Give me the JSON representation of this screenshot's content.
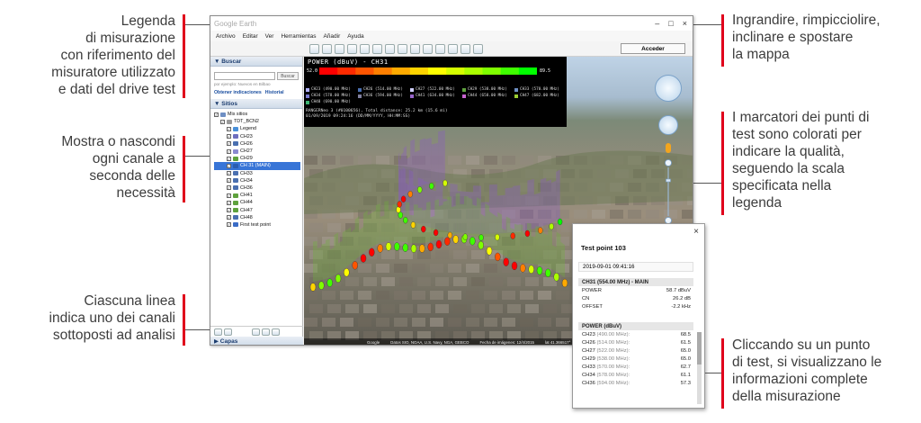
{
  "annotations": {
    "legend": [
      "Legenda",
      "di misurazione",
      "con riferimento del",
      "misuratore utilizzato",
      "e dati del drive test"
    ],
    "channels": [
      "Mostra o nascondi",
      "ogni canale a",
      "seconda delle",
      "necessità"
    ],
    "lines": [
      "Ciascuna linea",
      "indica uno dei canali",
      "sottoposti ad analisi"
    ],
    "zoom": [
      "Ingrandire, rimpicciolire,",
      "inclinare e spostare",
      "la mappa"
    ],
    "markers": [
      "I marcatori dei punti di",
      "test sono colorati per",
      "indicare la qualità,",
      "seguendo la scala",
      "specificata nella",
      "legenda"
    ],
    "click": [
      "Cliccando su un punto",
      "di test, si visualizzano le",
      "informazioni complete",
      "della misurazione"
    ]
  },
  "window": {
    "title": "Google Earth",
    "controls": [
      "–",
      "□",
      "×"
    ],
    "menu": [
      "Archivo",
      "Editar",
      "Ver",
      "Herramientas",
      "Añadir",
      "Ayuda"
    ],
    "acceder_label": "Acceder"
  },
  "sidebar": {
    "search_header": "▼ Buscar",
    "search_button": "Buscar",
    "search_hint": "por ejemplo: Nuevos en Bilbao",
    "links": [
      "Obtener indicaciones",
      "Historial"
    ],
    "places_header": "▼ Sitios",
    "layers_header": "▶ Capas",
    "tree": [
      {
        "label": "Mis sitios",
        "indent": 0,
        "color": "#6e8fc4"
      },
      {
        "label": "TDT_BCN2",
        "indent": 1,
        "color": "#999999"
      },
      {
        "label": "Legend",
        "indent": 2,
        "color": "#4a90d9"
      },
      {
        "label": "CH23",
        "indent": 2,
        "color": "#6e6ebf"
      },
      {
        "label": "CH26",
        "indent": 2,
        "color": "#4a6fb0"
      },
      {
        "label": "CH27",
        "indent": 2,
        "color": "#8a8ad0"
      },
      {
        "label": "CH29",
        "indent": 2,
        "color": "#5ea13d"
      },
      {
        "label": "CH 31 (MAIN)",
        "indent": 2,
        "color": "#2a5db0",
        "selected": true
      },
      {
        "label": "CH33",
        "indent": 2,
        "color": "#4a6fb0"
      },
      {
        "label": "CH34",
        "indent": 2,
        "color": "#4a6fb0"
      },
      {
        "label": "CH36",
        "indent": 2,
        "color": "#4a6fb0"
      },
      {
        "label": "CH41",
        "indent": 2,
        "color": "#5ea13d"
      },
      {
        "label": "CH44",
        "indent": 2,
        "color": "#5ea13d"
      },
      {
        "label": "CH47",
        "indent": 2,
        "color": "#5ea13d"
      },
      {
        "label": "CH48",
        "indent": 2,
        "color": "#4a6fb0"
      },
      {
        "label": "First test point",
        "indent": 2,
        "color": "#3a6cc6"
      }
    ]
  },
  "legend": {
    "title": "POWER (dBuV) - CH31",
    "min": "52.0",
    "max": "89.5",
    "scale_colors": [
      "#ff0000",
      "#ff2a00",
      "#ff5500",
      "#ff7f00",
      "#ffaa00",
      "#ffd400",
      "#ffff00",
      "#d4ff00",
      "#aaff00",
      "#7fff00",
      "#3fff00",
      "#00ff00"
    ],
    "channels": [
      {
        "label": "CH23 (490.00 MHz)",
        "color": "#b0b0ff"
      },
      {
        "label": "CH26 (514.00 MHz)",
        "color": "#4a6fb0"
      },
      {
        "label": "CH27 (522.00 MHz)",
        "color": "#d0d0ff"
      },
      {
        "label": "CH29 (538.00 MHz)",
        "color": "#5ea13d"
      },
      {
        "label": "CH33 (570.00 MHz)",
        "color": "#6e8fc4"
      },
      {
        "label": "CH34 (578.00 MHz)",
        "color": "#7a7ad0"
      },
      {
        "label": "CH36 (594.00 MHz)",
        "color": "#8080a0"
      },
      {
        "label": "CH41 (634.00 MHz)",
        "color": "#9966cc"
      },
      {
        "label": "CH44 (658.00 MHz)",
        "color": "#c864d0"
      },
      {
        "label": "CH47 (682.00 MHz)",
        "color": "#9acd32"
      },
      {
        "label": "CH48 (690.00 MHz)",
        "color": "#3cb371"
      }
    ],
    "info_lines": [
      "RANGERNeo 3 (#0100656), Total distance: 25.2 km (15.6 mi)",
      "01/09/2019 09:24:16 (DD/MM/YYYY, HH:MM:SS)"
    ]
  },
  "map_status": [
    "Google",
    "Datos SIO, NOAA, U.S. Navy, NGA, GEBCO",
    "Fecha de imágenes: 12/4/2015",
    "lat 41.366517°",
    "long 2.166..."
  ],
  "popup": {
    "close": "×",
    "title": "Test point 103",
    "date": "2019-09-01 09:41:16",
    "main_header": "CH31 (554.00 MHz) - MAIN",
    "main_rows": [
      {
        "k": "POWER",
        "v": "58.7 dBuV"
      },
      {
        "k": "CN",
        "v": "26.2 dB"
      },
      {
        "k": "OFFSET",
        "v": "-2.2 kHz"
      }
    ],
    "power_header": "POWER (dBuV)",
    "power_rows": [
      {
        "k": "CH23",
        "mhz": "(490.00 MHz):",
        "v": "68.5"
      },
      {
        "k": "CH26",
        "mhz": "(514.00 MHz):",
        "v": "61.5"
      },
      {
        "k": "CH27",
        "mhz": "(522.00 MHz):",
        "v": "65.0"
      },
      {
        "k": "CH29",
        "mhz": "(538.00 MHz):",
        "v": "65.0"
      },
      {
        "k": "CH33",
        "mhz": "(570.00 MHz):",
        "v": "62.7"
      },
      {
        "k": "CH34",
        "mhz": "(578.00 MHz):",
        "v": "61.1"
      },
      {
        "k": "CH36",
        "mhz": "(594.00 MHz):",
        "v": "57.3"
      }
    ]
  }
}
